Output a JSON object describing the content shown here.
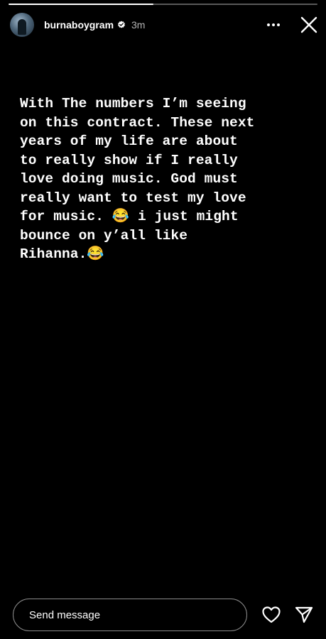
{
  "story": {
    "progress": 0.47,
    "username": "burnaboygram",
    "verified": true,
    "time_ago": "3m",
    "text": "With The numbers I’m seeing\non this contract. These next\nyears of my life are about\nto really show if I really\nlove doing music. God must\nreally want to test my love\nfor music. 😂 i just might\nbounce on y’all like\nRihanna.😂"
  },
  "header": {
    "more_icon": "more-horizontal-icon",
    "close_icon": "close-icon"
  },
  "footer": {
    "message_placeholder": "Send message",
    "like_icon": "heart-icon",
    "share_icon": "send-icon"
  },
  "colors": {
    "background": "#000000",
    "text": "#ffffff",
    "verified_badge": "#ffffff"
  }
}
